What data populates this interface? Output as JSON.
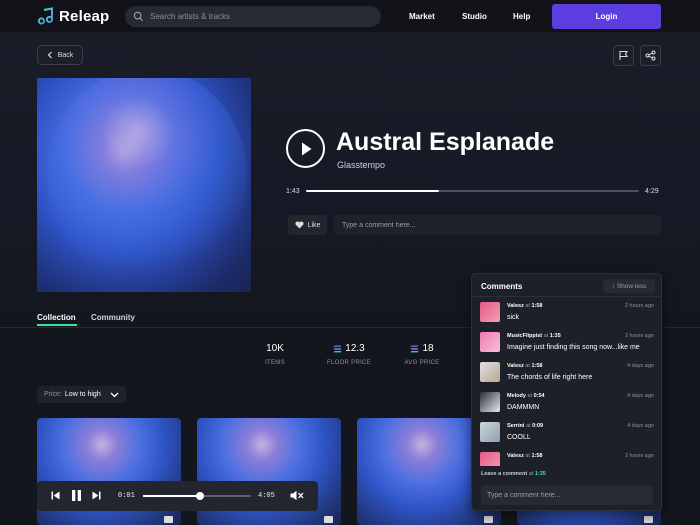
{
  "header": {
    "app_name": "Releap",
    "search_placeholder": "Search artists & tracks",
    "nav": [
      "Market",
      "Studio",
      "Help"
    ],
    "login_label": "Login"
  },
  "hero": {
    "back_label": "Back",
    "track_title": "Austral Esplanade",
    "artist": "Glasstempo",
    "elapsed": "1:43",
    "duration": "4:29",
    "progress": 0.4,
    "like_label": "Like",
    "comment_placeholder": "Type a comment here..."
  },
  "tabs": [
    {
      "label": "Collection",
      "active": true
    },
    {
      "label": "Community",
      "active": false
    }
  ],
  "stats": [
    {
      "value": "10K",
      "label": "ITEMS",
      "icon": ""
    },
    {
      "value": "12.3",
      "label": "FLOOR PRICE",
      "icon": "solana-icon"
    },
    {
      "value": "18",
      "label": "AVG PRICE",
      "icon": "solana-icon"
    }
  ],
  "filter": {
    "key": "Price:",
    "value": "Low to high"
  },
  "player": {
    "elapsed": "0:01",
    "duration": "4:05",
    "progress": 0.53
  },
  "comments": {
    "title": "Comments",
    "show_less_label": "Show less",
    "items": [
      {
        "user": "Valesz",
        "at": "at",
        "time": "1:58",
        "ago": "2 hours ago",
        "text": "sick"
      },
      {
        "user": "MusicFlippist",
        "at": "at",
        "time": "1:35",
        "ago": "2 hours ago",
        "text": "Imagine just finding this song now...like me"
      },
      {
        "user": "Valesz",
        "at": "at",
        "time": "1:58",
        "ago": "4 days ago",
        "text": "The chords of life right here"
      },
      {
        "user": "Melody",
        "at": "at",
        "time": "0:54",
        "ago": "4 days ago",
        "text": "DAMMMN"
      },
      {
        "user": "Serrini",
        "at": "at",
        "time": "0:09",
        "ago": "4 days ago",
        "text": "COOLL"
      },
      {
        "user": "Valesz",
        "at": "at",
        "time": "1:58",
        "ago": "2 hours ago",
        "text": ""
      }
    ],
    "leave_prefix": "Leave a comment",
    "leave_at": "at",
    "leave_time": "1:35",
    "input_placeholder": "Type a comment here..."
  },
  "colors": {
    "accent": "#5b3de0",
    "tab_underline": "#3fe0a8",
    "background": "#14161d"
  }
}
